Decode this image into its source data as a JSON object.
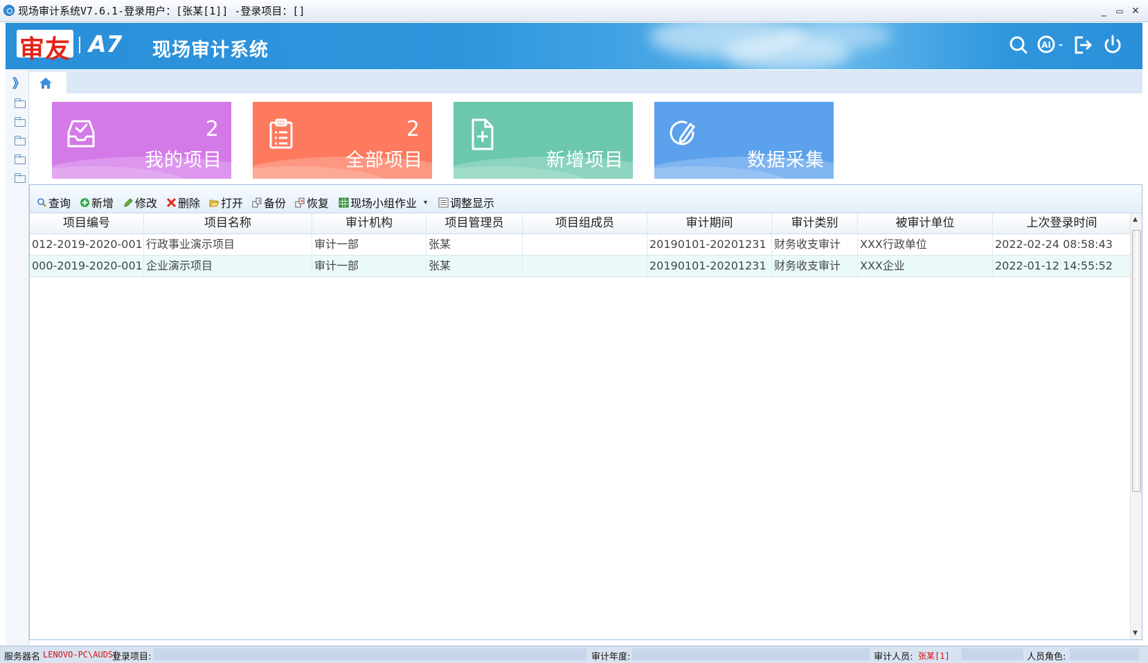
{
  "window": {
    "title": "现场审计系统V7.6.1-登录用户：[张某[1]] -登录项目：[]",
    "minimize": "_",
    "maximize": "▭",
    "close": "✕"
  },
  "banner": {
    "brand": "审友",
    "model": "A7",
    "system_title": "现场审计系统",
    "icons": [
      "search-icon",
      "ai-assistant-icon",
      "logout-icon",
      "power-icon"
    ]
  },
  "sidebar": {
    "expand_glyph": "》",
    "folders": [
      "folder-icon",
      "folder-icon",
      "folder-icon",
      "folder-icon",
      "folder-icon"
    ]
  },
  "tabs": {
    "home_icon": "home-icon"
  },
  "tiles": [
    {
      "label": "我的项目",
      "count": "2",
      "color": "#d479e8",
      "icon": "inbox-check-icon"
    },
    {
      "label": "全部项目",
      "count": "2",
      "color": "#fd7a5f",
      "icon": "clipboard-list-icon"
    },
    {
      "label": "新增项目",
      "count": "",
      "color": "#6cc8ad",
      "icon": "file-add-icon"
    },
    {
      "label": "数据采集",
      "count": "",
      "color": "#5ba1ec",
      "icon": "edit-circle-icon"
    }
  ],
  "toolbar": {
    "query": "查询",
    "add": "新增",
    "edit": "修改",
    "delete": "删除",
    "open": "打开",
    "backup": "备份",
    "restore": "恢复",
    "team_work": "现场小组作业",
    "adjust_display": "调整显示"
  },
  "table": {
    "columns": [
      "项目编号",
      "项目名称",
      "审计机构",
      "项目管理员",
      "项目组成员",
      "审计期间",
      "审计类别",
      "被审计单位",
      "上次登录时间"
    ],
    "rows": [
      [
        "012-2019-2020-001",
        "行政事业演示项目",
        "审计一部",
        "张某",
        "",
        "20190101-20201231",
        "财务收支审计",
        "XXX行政单位",
        "2022-02-24 08:58:43"
      ],
      [
        "000-2019-2020-001",
        "企业演示项目",
        "审计一部",
        "张某",
        "",
        "20190101-20201231",
        "财务收支审计",
        "XXX企业",
        "2022-01-12 14:55:52"
      ]
    ]
  },
  "statusbar": {
    "server_label": "服务器名",
    "server_value": "LENOVO-PC\\AUDS(",
    "login_project_label": "登录项目:",
    "audit_year_label": "审计年度:",
    "auditor_label": "审计人员:",
    "auditor_value": "张某[1]",
    "role_label": "人员角色:"
  }
}
